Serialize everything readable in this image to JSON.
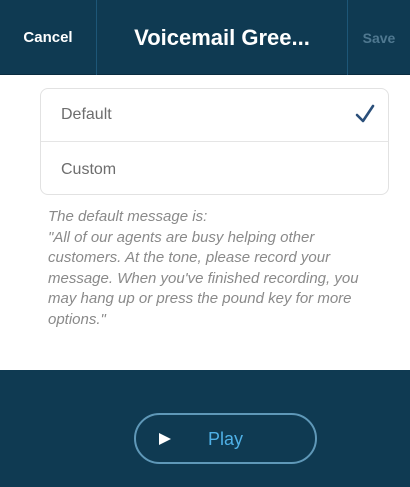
{
  "navbar": {
    "cancel_label": "Cancel",
    "title": "Voicemail Gree...",
    "save_label": "Save"
  },
  "options": [
    {
      "label": "Default",
      "selected": true
    },
    {
      "label": "Custom",
      "selected": false
    }
  ],
  "message": {
    "heading": "The default message is:",
    "body": "\"All of our agents are busy helping other customers. At the tone, please record your message. When you've finished recording, you may hang up or press the pound key for more options.\""
  },
  "footer": {
    "play_label": "Play"
  },
  "icons": {
    "check": "check-icon",
    "play": "play-icon"
  },
  "colors": {
    "navbar_bg": "#0f3a52",
    "check": "#2a4f7a",
    "play_text": "#4fb0e6",
    "play_border": "#5f98b8"
  }
}
